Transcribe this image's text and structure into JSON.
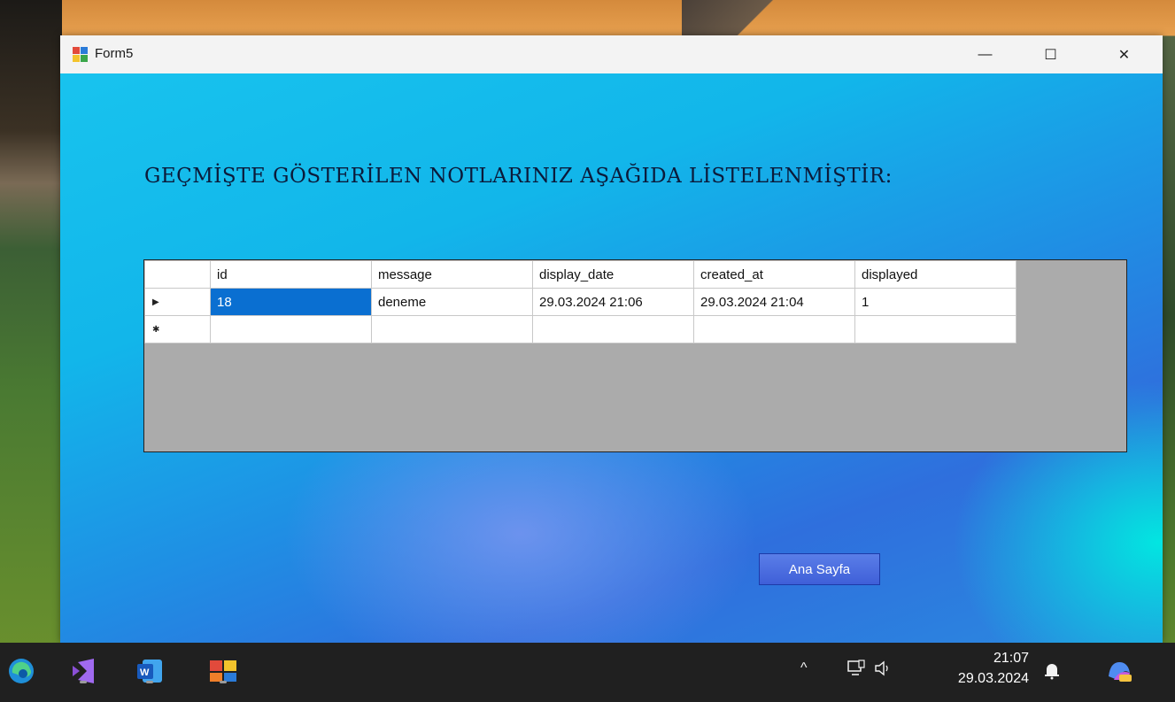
{
  "window": {
    "title": "Form5"
  },
  "titlebar_buttons": {
    "minimize": "—",
    "maximize": "☐",
    "close": "✕"
  },
  "heading": "GEÇMİŞTE GÖSTERİLEN NOTLARINIZ AŞAĞIDA LİSTELENMİŞTİR:",
  "grid": {
    "columns": [
      "id",
      "message",
      "display_date",
      "created_at",
      "displayed"
    ],
    "rows": [
      {
        "marker": "▶",
        "cells": [
          "18",
          "deneme",
          "29.03.2024 21:06",
          "29.03.2024 21:04",
          "1"
        ]
      },
      {
        "marker": "✱",
        "cells": [
          "",
          "",
          "",
          "",
          ""
        ]
      }
    ],
    "selected_cell_color": "#0a6fd1"
  },
  "buttons": {
    "home": "Ana Sayfa"
  },
  "taskbar": {
    "apps": [
      "edge-icon",
      "visual-studio-icon",
      "word-icon",
      "windows-forms-app-icon"
    ],
    "tray": {
      "chevron": "^",
      "network_icon": "network-icon",
      "volume_icon": "volume-icon"
    },
    "clock": {
      "time": "21:07",
      "date": "29.03.2024"
    }
  },
  "colors": {
    "accent": "#0a6fd1",
    "button": "#4a6be0",
    "taskbar": "#202020"
  }
}
